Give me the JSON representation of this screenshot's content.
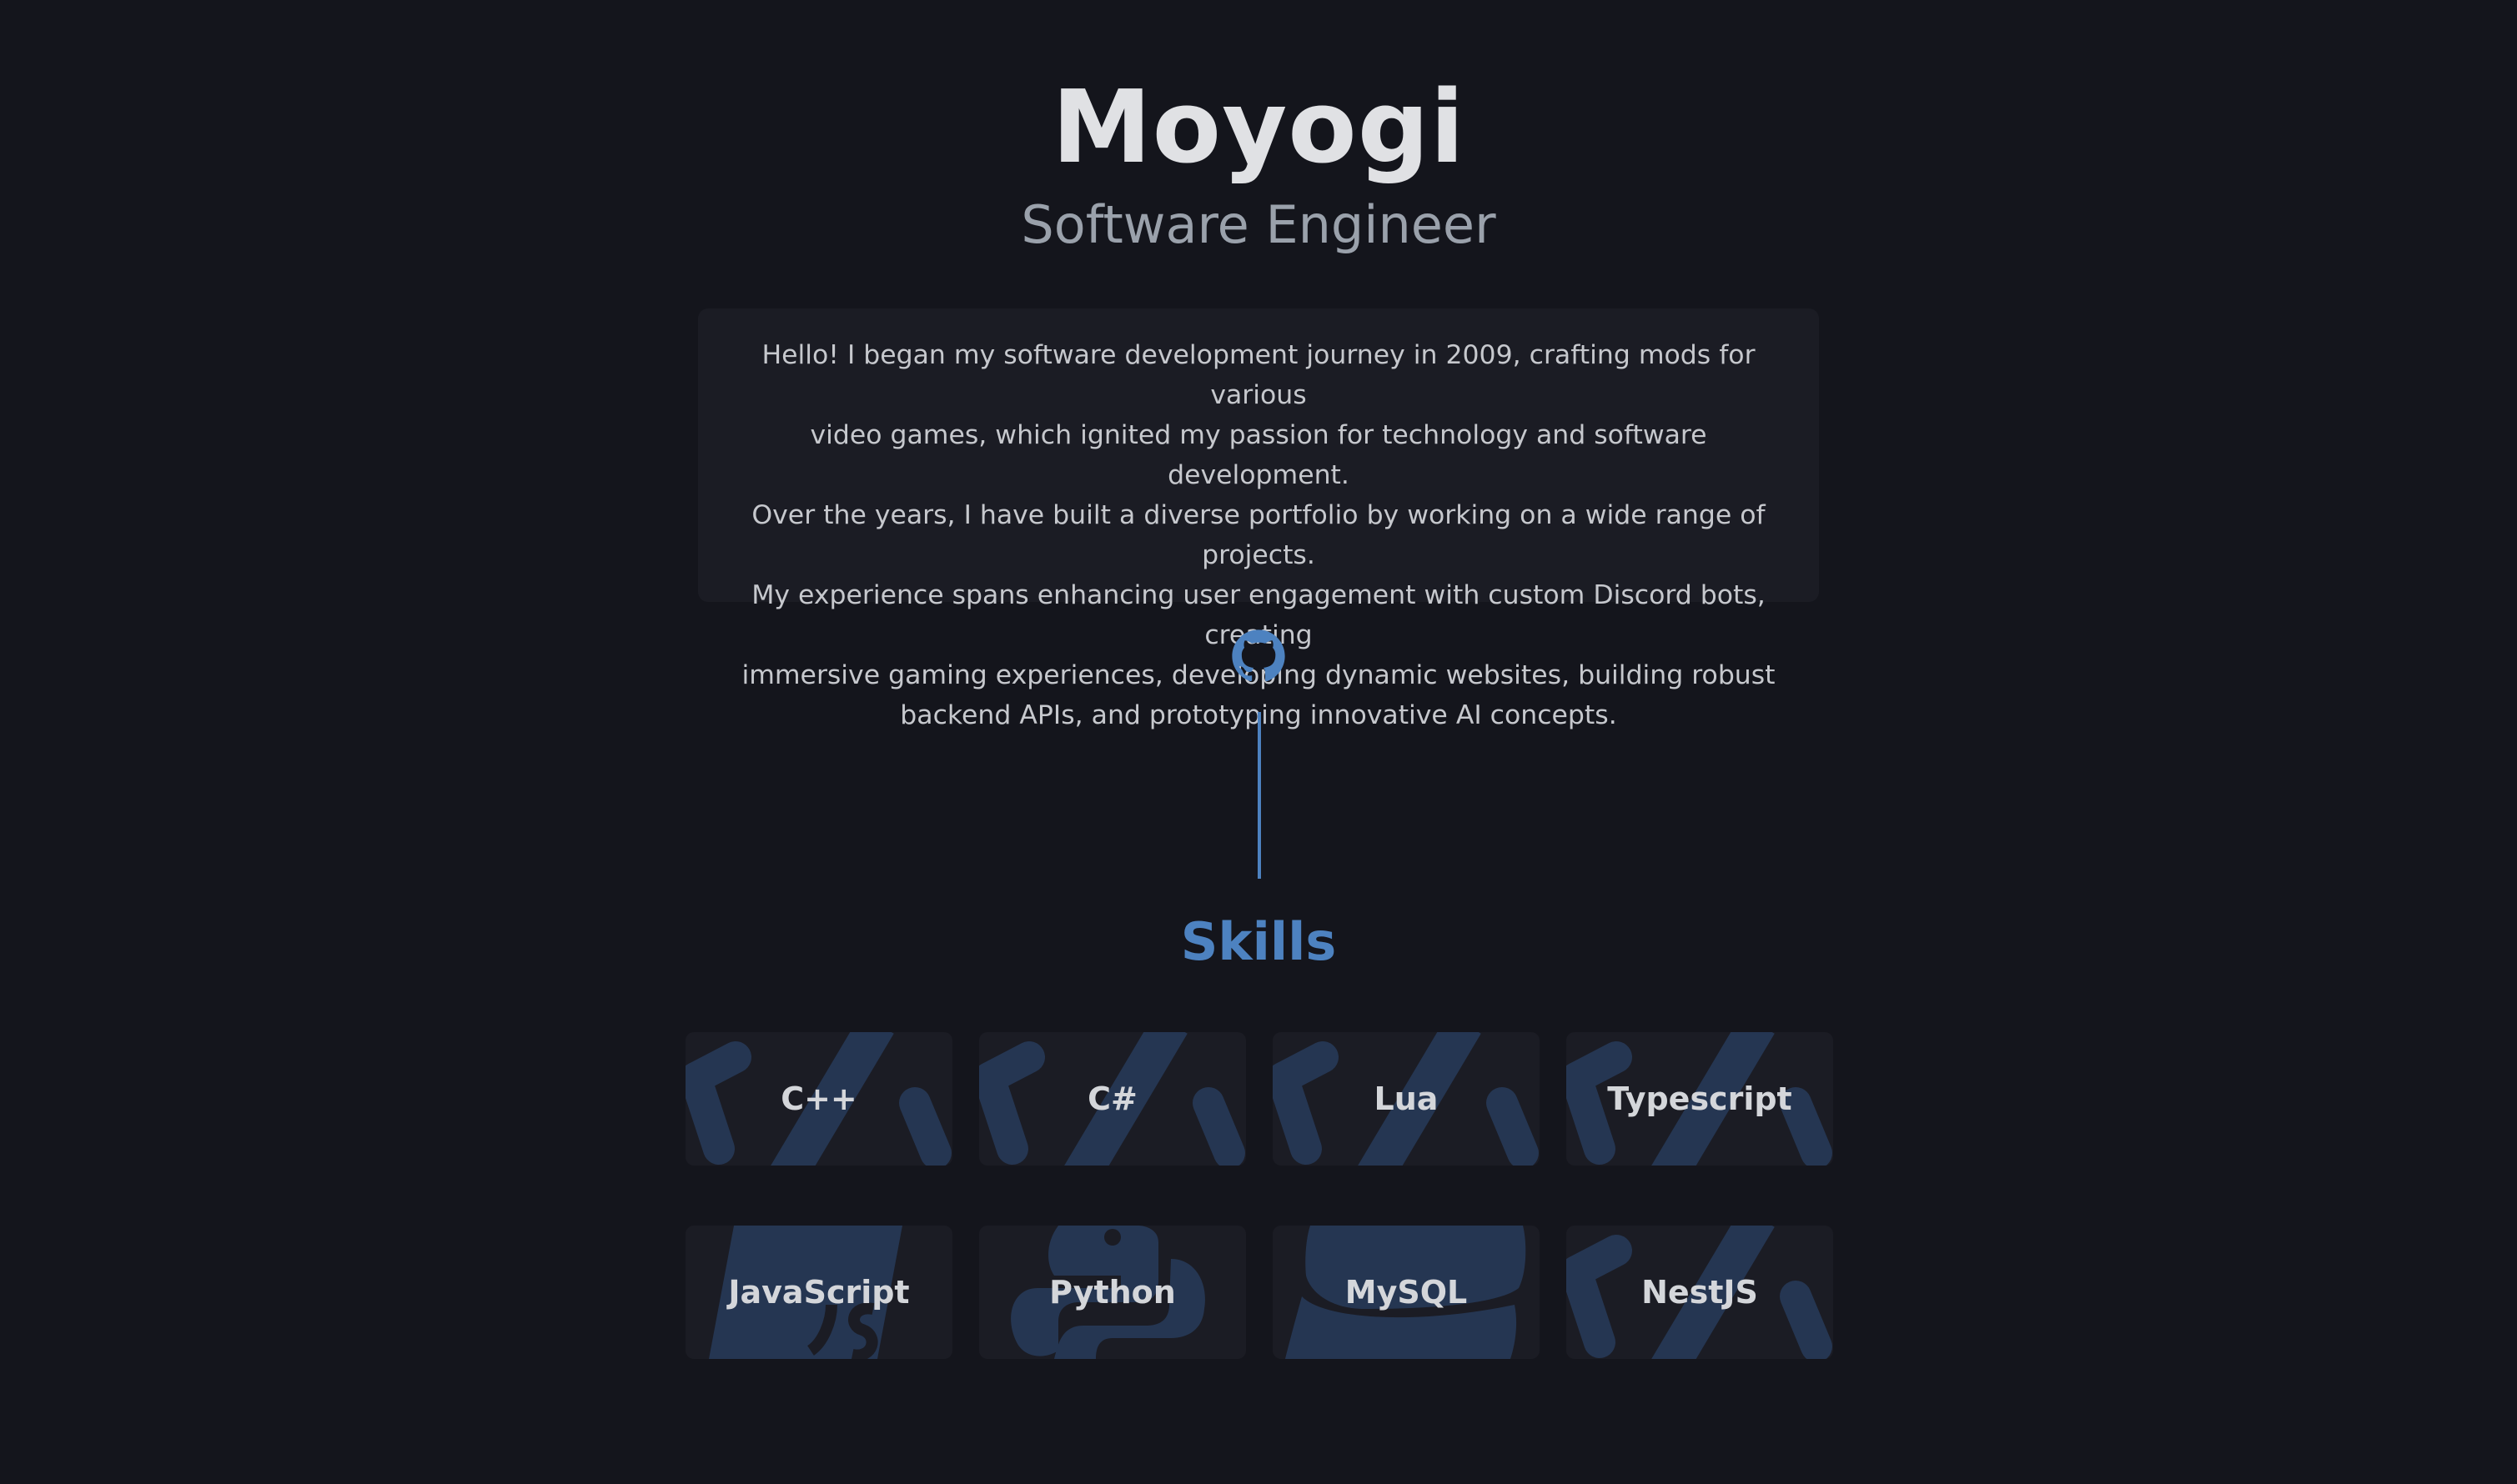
{
  "header": {
    "name": "Moyogi",
    "role": "Software Engineer"
  },
  "bio": {
    "lines": [
      "Hello! I began my software development journey in 2009, crafting mods for various",
      "video games, which ignited my passion for technology and software development.",
      "Over the years, I have built a diverse portfolio by working on a wide range of projects.",
      "My experience spans enhancing user engagement with custom Discord bots, creating",
      "immersive gaming experiences, developing dynamic websites, building robust",
      "backend APIs, and prototyping innovative AI concepts."
    ]
  },
  "links": {
    "github_icon": "github-icon"
  },
  "skills": {
    "title": "Skills",
    "items": [
      {
        "label": "C++",
        "icon": "code-icon"
      },
      {
        "label": "C#",
        "icon": "code-icon"
      },
      {
        "label": "Lua",
        "icon": "code-icon"
      },
      {
        "label": "Typescript",
        "icon": "code-icon"
      },
      {
        "label": "JavaScript",
        "icon": "js-icon"
      },
      {
        "label": "Python",
        "icon": "python-icon"
      },
      {
        "label": "MySQL",
        "icon": "database-icon"
      },
      {
        "label": "NestJS",
        "icon": "code-icon"
      }
    ]
  },
  "colors": {
    "background": "#14151c",
    "card": "#1b1c24",
    "accent": "#4d82c0",
    "icon_watermark": "#253652",
    "title_text": "#e0e1e4",
    "subtitle_text": "#9aa1ab"
  }
}
